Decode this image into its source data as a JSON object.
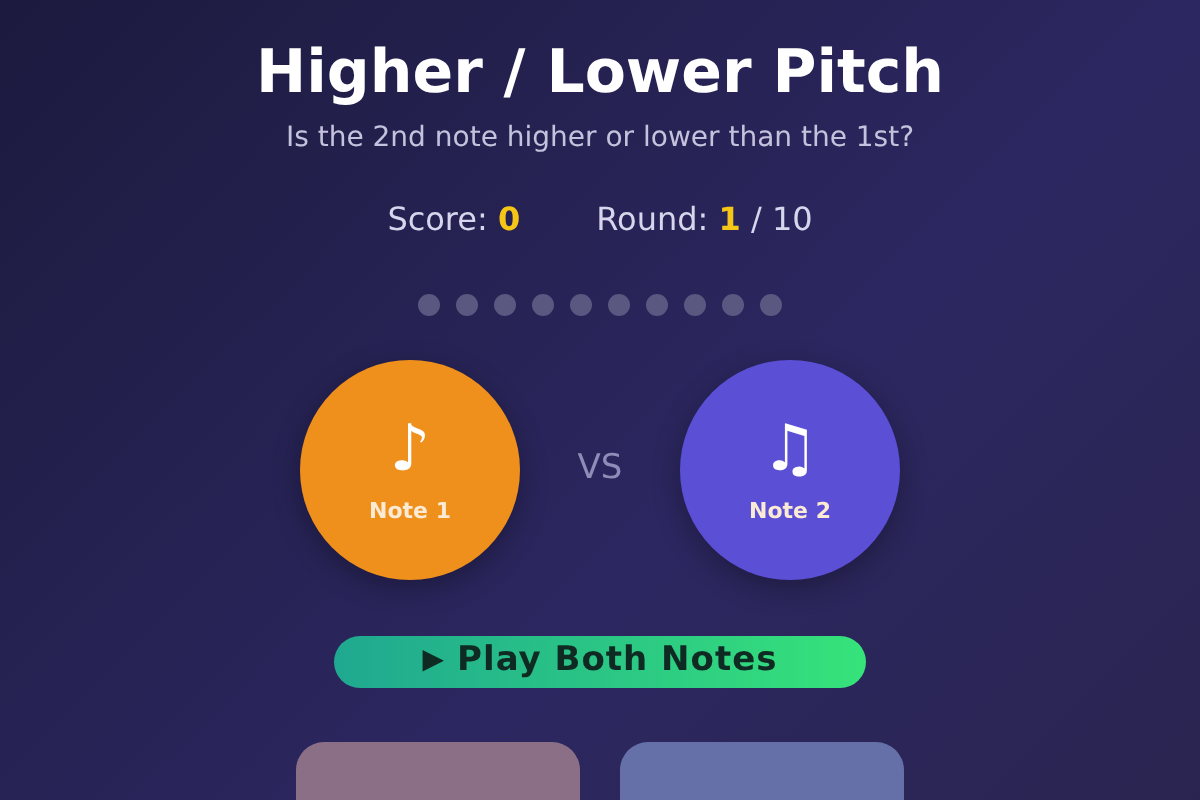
{
  "title": "Higher / Lower Pitch",
  "subtitle": "Is the 2nd note higher or lower than the 1st?",
  "score": {
    "label": "Score:",
    "value": "0"
  },
  "round": {
    "label": "Round:",
    "current": "1",
    "total": "/ 10"
  },
  "progress": [
    {
      "done": false
    },
    {
      "done": false
    },
    {
      "done": false
    },
    {
      "done": false
    },
    {
      "done": false
    },
    {
      "done": false
    },
    {
      "done": false
    },
    {
      "done": false
    },
    {
      "done": false
    },
    {
      "done": false
    }
  ],
  "notes": [
    {
      "symbol": "♪",
      "label": "Note 1",
      "color": "#f0901c"
    },
    {
      "symbol": "♫",
      "label": "Note 2",
      "color": "#5b4fd6"
    }
  ],
  "versus": "VS",
  "play_button": {
    "icon": "▶",
    "label": "Play Both Notes"
  },
  "answer_buttons": [
    {
      "color": "#8b6f86"
    },
    {
      "color": "#6670a8"
    }
  ]
}
